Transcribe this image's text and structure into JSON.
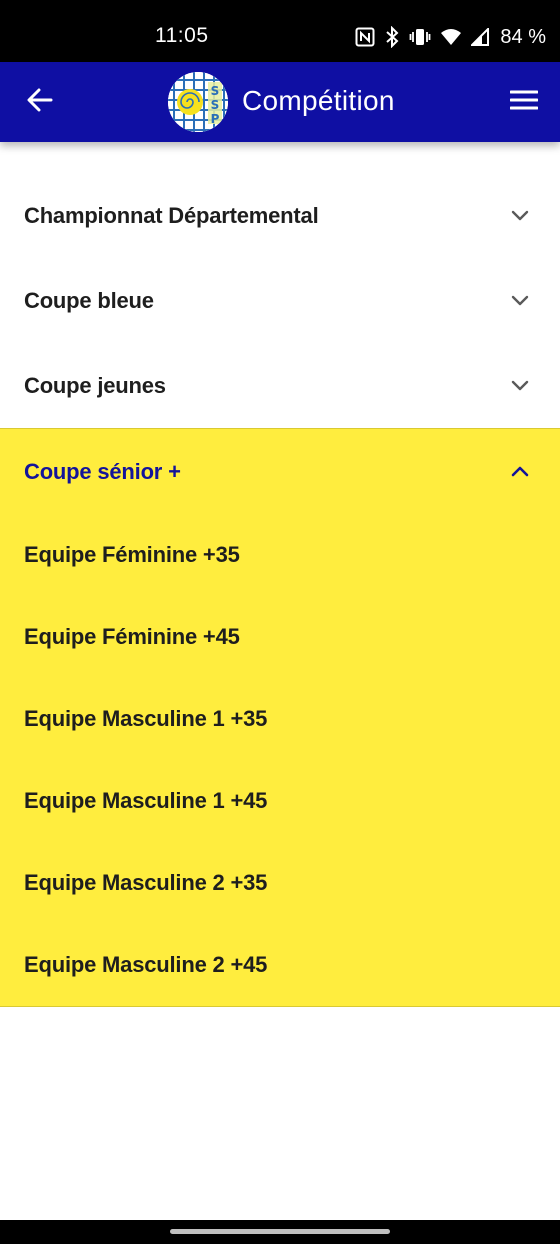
{
  "status_bar": {
    "time": "11:05",
    "battery": "84 %",
    "icons": [
      "nfc-icon",
      "bluetooth-icon",
      "vibrate-icon",
      "wifi-icon",
      "signal-icon"
    ]
  },
  "app_bar": {
    "title": "Compétition",
    "back_icon": "arrow-left-icon",
    "menu_icon": "hamburger-menu-icon",
    "logo_letters": [
      "S",
      "S",
      "P"
    ],
    "background_color": "#0f0fa3"
  },
  "accordion": {
    "sections": [
      {
        "label": "Championnat Départemental",
        "expanded": false
      },
      {
        "label": "Coupe bleue",
        "expanded": false
      },
      {
        "label": "Coupe jeunes",
        "expanded": false
      },
      {
        "label": "Coupe sénior +",
        "expanded": true,
        "items": [
          "Equipe Féminine +35",
          "Equipe Féminine +45",
          "Equipe Masculine 1 +35",
          "Equipe Masculine 1 +45",
          "Equipe Masculine 2 +35",
          "Equipe Masculine 2 +45"
        ]
      }
    ],
    "expanded_background": "#ffed3e",
    "expanded_label_color": "#13139a"
  }
}
